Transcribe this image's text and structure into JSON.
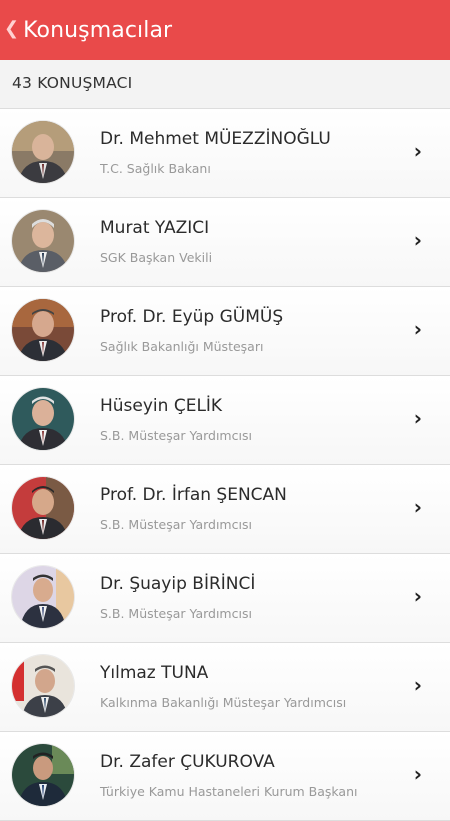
{
  "header": {
    "back_label": "Konuşmacılar",
    "bg_color": "#e94a4a"
  },
  "summary": {
    "count_label": "43 KONUŞMACI"
  },
  "speakers": [
    {
      "name": "Dr. Mehmet MÜEZZİNOĞLU",
      "role": "T.C. Sağlık Bakanı"
    },
    {
      "name": "Murat YAZICI",
      "role": "SGK Başkan Vekili"
    },
    {
      "name": "Prof. Dr. Eyüp GÜMÜŞ",
      "role": "Sağlık Bakanlığı Müsteşarı"
    },
    {
      "name": "Hüseyin ÇELİK",
      "role": "S.B. Müsteşar Yardımcısı"
    },
    {
      "name": "Prof. Dr. İrfan ŞENCAN",
      "role": "S.B. Müsteşar Yardımcısı"
    },
    {
      "name": "Dr. Şuayip BİRİNCİ",
      "role": "S.B. Müsteşar Yardımcısı"
    },
    {
      "name": "Yılmaz TUNA",
      "role": "Kalkınma Bakanlığı Müsteşar Yardımcısı"
    },
    {
      "name": "Dr. Zafer ÇUKUROVA",
      "role": "Türkiye Kamu Hastaneleri Kurum Başkanı"
    }
  ],
  "icons": {
    "back": "chevron-left-icon",
    "row_arrow": "chevron-right-icon",
    "avatar": "speaker-photo"
  }
}
